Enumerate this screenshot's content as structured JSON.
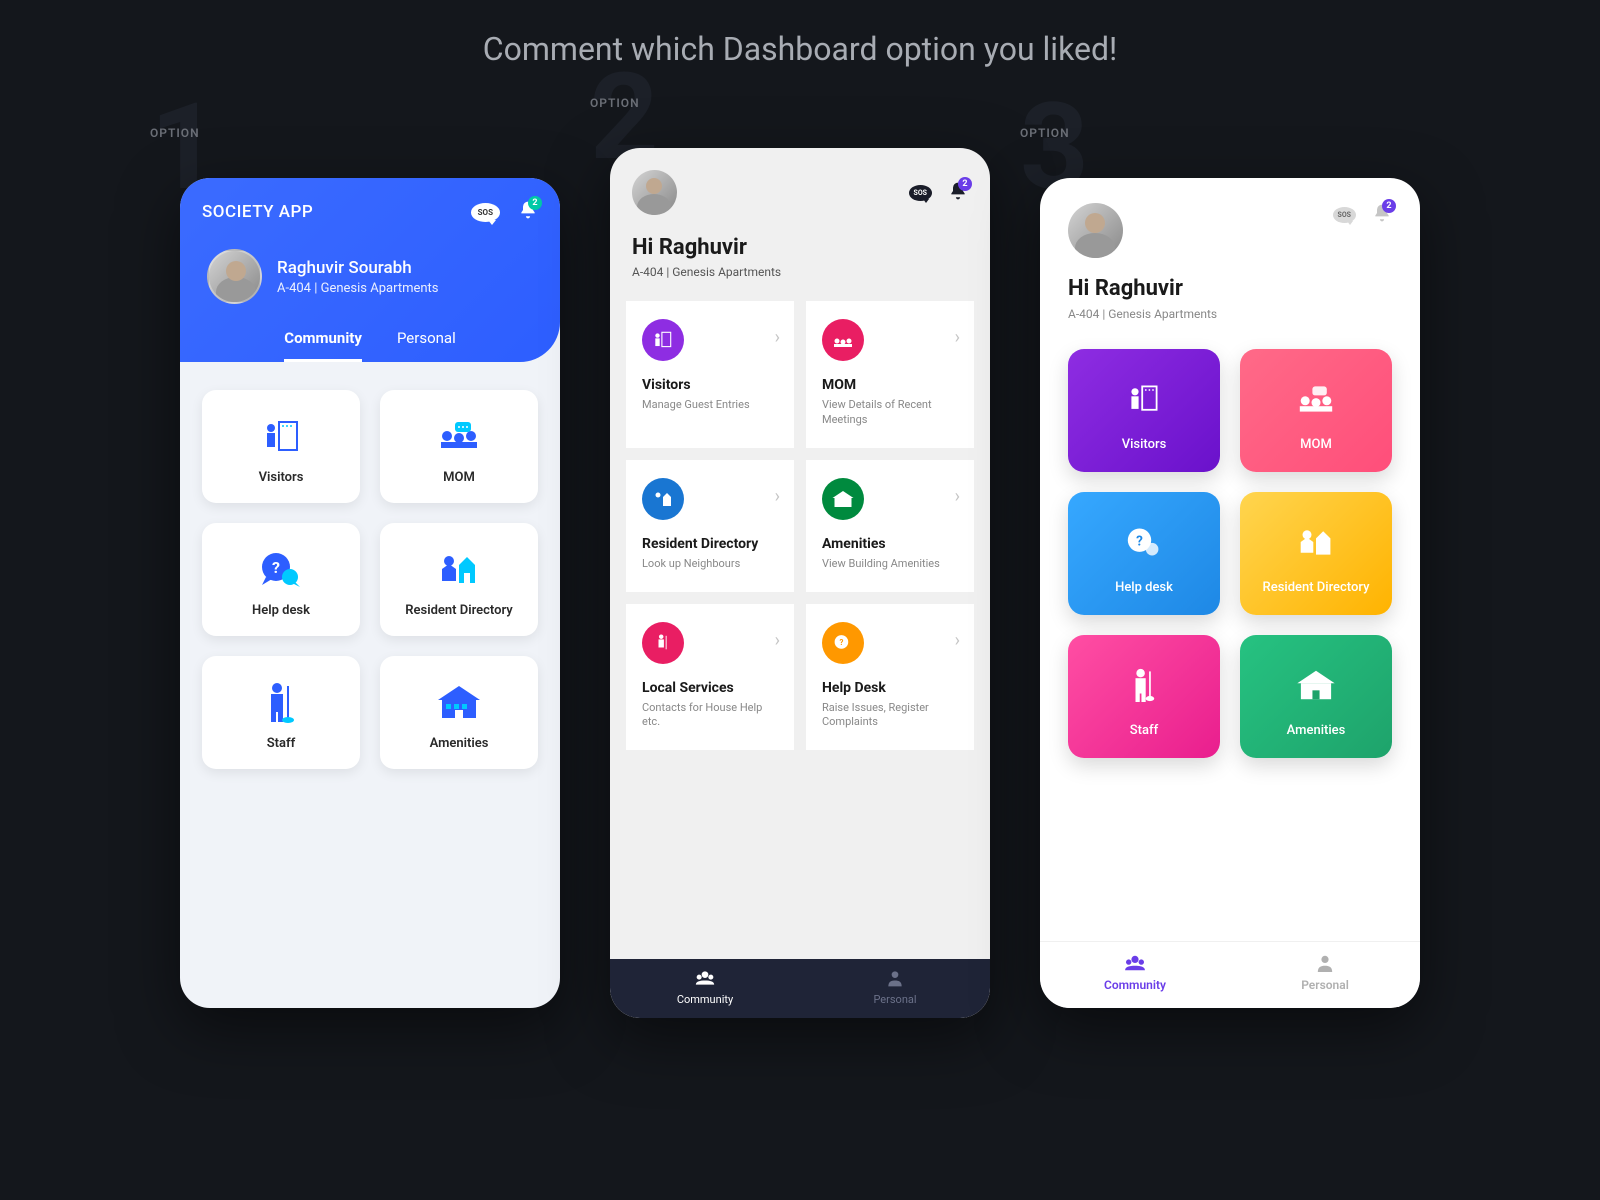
{
  "page_title": "Comment which Dashboard option you liked!",
  "option_label": "OPTION",
  "options": [
    "1",
    "2",
    "3"
  ],
  "badge_count": "2",
  "sos_text": "SOS",
  "o1": {
    "app_name": "SOCIETY APP",
    "user_name": "Raghuvir Sourabh",
    "address": "A-404 | Genesis Apartments",
    "tabs": {
      "community": "Community",
      "personal": "Personal"
    },
    "cards": {
      "visitors": "Visitors",
      "mom": "MOM",
      "helpdesk": "Help desk",
      "directory": "Resident Directory",
      "staff": "Staff",
      "amenities": "Amenities"
    }
  },
  "o2": {
    "greeting": "Hi Raghuvir",
    "address": "A-404 | Genesis Apartments",
    "cards": {
      "visitors": {
        "title": "Visitors",
        "sub": "Manage Guest Entries",
        "color": "#8e2de2"
      },
      "mom": {
        "title": "MOM",
        "sub": "View Details of Recent Meetings",
        "color": "#e91e63"
      },
      "directory": {
        "title": "Resident Directory",
        "sub": "Look up Neighbours",
        "color": "#1976d2"
      },
      "amenities": {
        "title": "Amenities",
        "sub": "View Building Amenities",
        "color": "#008a3e"
      },
      "services": {
        "title": "Local Services",
        "sub": "Contacts for House Help etc.",
        "color": "#e91e63"
      },
      "helpdesk": {
        "title": "Help Desk",
        "sub": "Raise Issues, Register Complaints",
        "color": "#ff9800"
      }
    },
    "nav": {
      "community": "Community",
      "personal": "Personal"
    }
  },
  "o3": {
    "greeting": "Hi Raghuvir",
    "address": "A-404 | Genesis Apartments",
    "cards": {
      "visitors": {
        "label": "Visitors",
        "bg": "linear-gradient(135deg,#8e2de2,#6a11cb)"
      },
      "mom": {
        "label": "MOM",
        "bg": "linear-gradient(135deg,#ff6a88,#ff4e7a)"
      },
      "helpdesk": {
        "label": "Help desk",
        "bg": "linear-gradient(135deg,#36a8ff,#1e88e5)"
      },
      "directory": {
        "label": "Resident Directory",
        "bg": "linear-gradient(135deg,#ffd54f,#ffb300)"
      },
      "staff": {
        "label": "Staff",
        "bg": "linear-gradient(135deg,#ff4ea3,#e91e8e)"
      },
      "amenities": {
        "label": "Amenities",
        "bg": "linear-gradient(135deg,#26c281,#1ea36b)"
      }
    },
    "nav": {
      "community": "Community",
      "personal": "Personal"
    }
  }
}
